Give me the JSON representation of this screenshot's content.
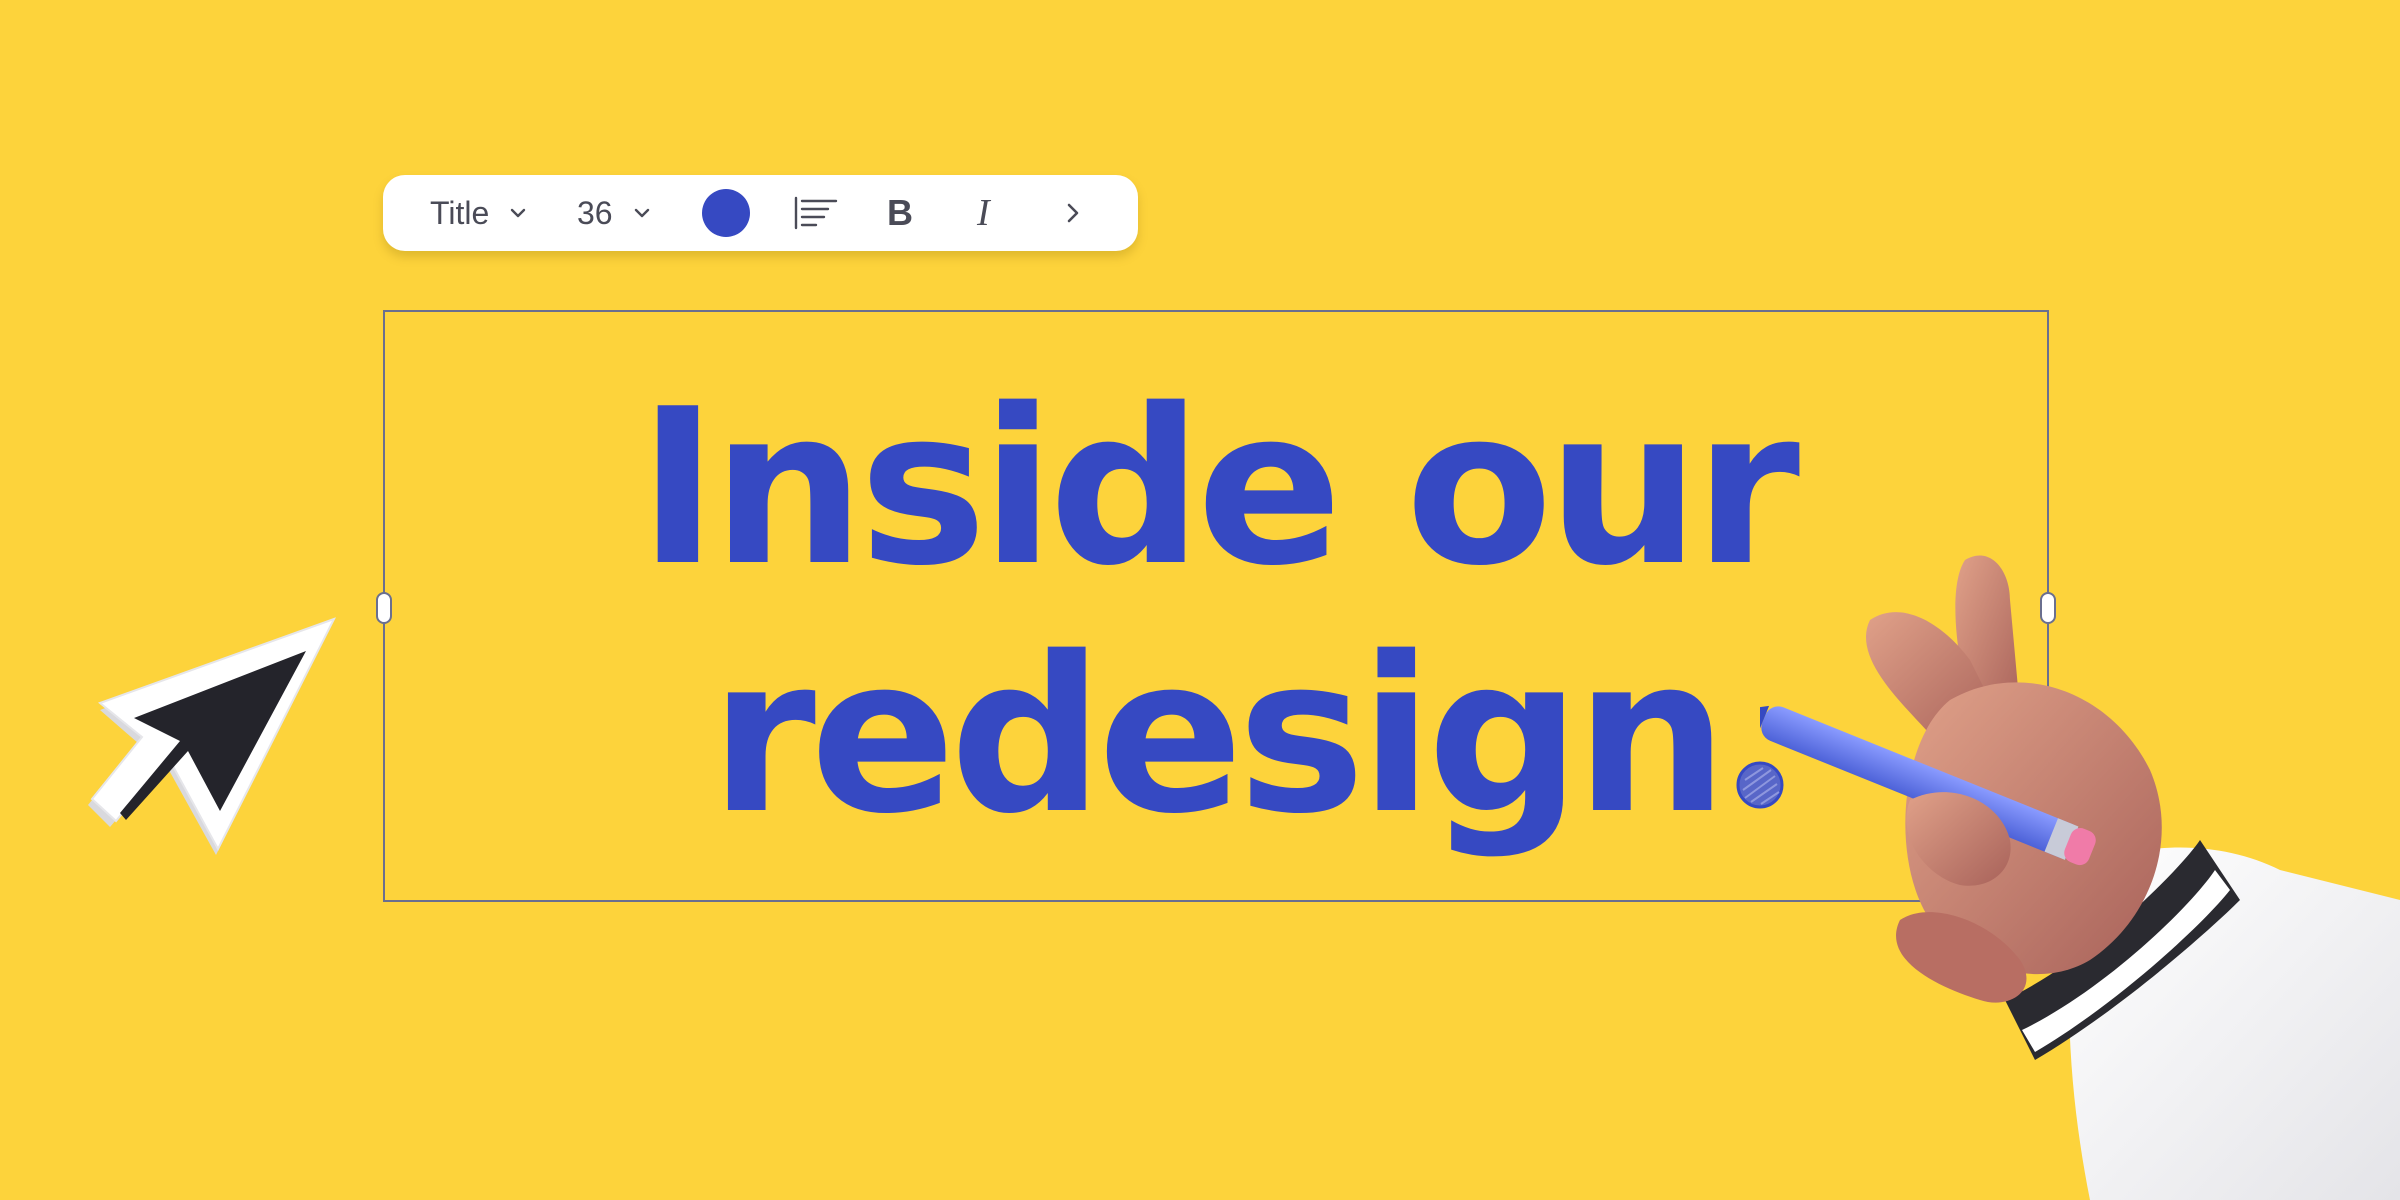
{
  "toolbar": {
    "text_style": "Title",
    "font_size": "36",
    "text_color": "#3649C2",
    "align_icon": "align-left-icon",
    "bold_label": "B",
    "italic_label": "I",
    "more_icon": "chevron-right-icon"
  },
  "textbox": {
    "line1": "Inside our",
    "line2": "redesign"
  },
  "colors": {
    "background": "#FDD33B",
    "accent": "#3649C2",
    "selection_border": "#6A6F8F"
  }
}
